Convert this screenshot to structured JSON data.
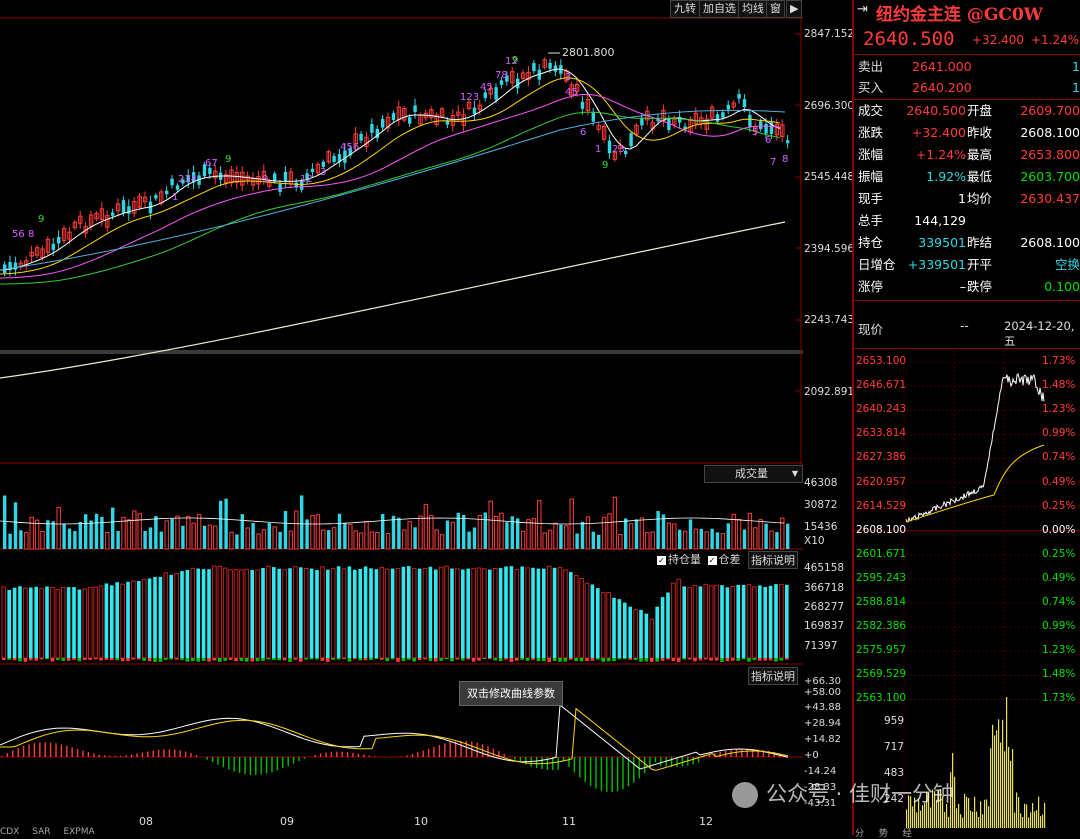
{
  "toolbar": {
    "buttons": [
      "九转",
      "加自选",
      "均线",
      "窗"
    ],
    "arrow": "▶"
  },
  "main_chart": {
    "y_labels": [
      "2847.152",
      "2696.300",
      "2545.448",
      "2394.596",
      "2243.743",
      "2092.891"
    ],
    "peak_label": "2801.800",
    "nine_digits_green": [
      "9",
      "9",
      "9",
      "9"
    ],
    "nine_digits_purple": [
      "56",
      "8",
      "234",
      "67",
      "1",
      "123",
      "45",
      "78",
      "12",
      "3",
      "45",
      "6",
      "1",
      "23",
      "5",
      "6",
      "7",
      "8",
      "9",
      "12",
      "3",
      "456"
    ]
  },
  "volume_panel": {
    "selector_label": "成交量",
    "y_labels": [
      "46308",
      "30872",
      "15436"
    ],
    "unit": "X10"
  },
  "oi_panel": {
    "checkbox_1": "持仓量",
    "checkbox_2": "仓差",
    "explain": "指标说明",
    "y_labels": [
      "465158",
      "366718",
      "268277",
      "169837",
      "71397"
    ]
  },
  "macd_panel": {
    "explain": "指标说明",
    "y_labels": [
      "+66.30",
      "+58.00",
      "+43.88",
      "+28.94",
      "+14.82",
      "+0",
      "-14.24",
      "-28.33",
      "-43.31"
    ],
    "tooltip": "双击修改曲线参数"
  },
  "x_axis": {
    "labels": [
      "08",
      "09",
      "10",
      "11",
      "12"
    ],
    "bottom_tabs": [
      "CDX",
      "SAR",
      "EXPMA"
    ]
  },
  "quote": {
    "title": "纽约金主连 @GC0W",
    "price": "2640.500",
    "change": "+32.400",
    "change_pct": "+1.24%",
    "sell_label": "卖出",
    "sell_price": "2641.000",
    "sell_qty": "1",
    "buy_label": "买入",
    "buy_price": "2640.200",
    "buy_qty": "1",
    "rows": [
      {
        "l1": "成交",
        "v1": "2640.500",
        "l2": "开盘",
        "v2": "2609.700",
        "c1": "red",
        "c2": "red"
      },
      {
        "l1": "涨跌",
        "v1": "+32.400",
        "l2": "昨收",
        "v2": "2608.100",
        "c1": "red",
        "c2": "white"
      },
      {
        "l1": "涨幅",
        "v1": "+1.24%",
        "l2": "最高",
        "v2": "2653.800",
        "c1": "red",
        "c2": "red"
      },
      {
        "l1": "振幅",
        "v1": "1.92%",
        "l2": "最低",
        "v2": "2603.700",
        "c1": "cyan",
        "c2": "green"
      },
      {
        "l1": "现手",
        "v1": "1",
        "l2": "均价",
        "v2": "2630.437",
        "c1": "white",
        "c2": "red"
      },
      {
        "l1": "总手",
        "v1": "144,129",
        "l2": "",
        "v2": "",
        "c1": "white",
        "c2": "white"
      },
      {
        "l1": "持仓",
        "v1": "339501",
        "l2": "昨结",
        "v2": "2608.100",
        "c1": "cyan",
        "c2": "white"
      },
      {
        "l1": "日增仓",
        "v1": "+339501",
        "l2": "开平",
        "v2": "空换",
        "c1": "cyan",
        "c2": "cyan"
      },
      {
        "l1": "涨停",
        "v1": "–",
        "l2": "跌停",
        "v2": "0.100",
        "c1": "white",
        "c2": "green"
      }
    ],
    "now_label": "现价",
    "now_value": "--",
    "date": "2024-12-20,五"
  },
  "intraday": {
    "price_labels": [
      "2653.100",
      "2646.671",
      "2640.243",
      "2633.814",
      "2627.386",
      "2620.957",
      "2614.529",
      "2608.100",
      "2601.671",
      "2595.243",
      "2588.814",
      "2582.386",
      "2575.957",
      "2569.529",
      "2563.100"
    ],
    "pct_labels": [
      "1.73%",
      "1.48%",
      "1.23%",
      "0.99%",
      "0.74%",
      "0.49%",
      "0.25%",
      "0.00%",
      "0.25%",
      "0.49%",
      "0.74%",
      "0.99%",
      "1.23%",
      "1.48%",
      "1.73%"
    ],
    "vol_labels": [
      "959",
      "717",
      "483",
      "242"
    ],
    "bottom_tabs": [
      "分",
      "势",
      "经"
    ]
  },
  "watermark": "公众号 · 佳财一分钟",
  "colors": {
    "up": "#ff3b3b",
    "down": "#2fd7e6",
    "grid": "#8b0000",
    "ma_white": "#f0f0d0"
  }
}
